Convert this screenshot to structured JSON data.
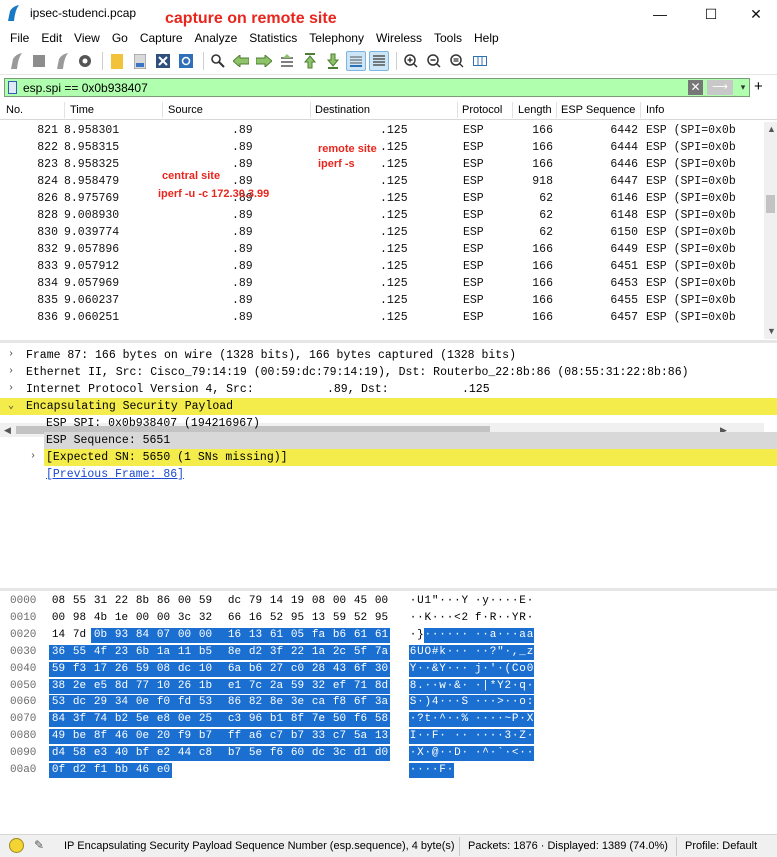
{
  "window": {
    "title": "ipsec-studenci.pcap",
    "annotation": "capture on remote site",
    "minimize": "—",
    "maximize": "☐",
    "close": "✕"
  },
  "menu": [
    "File",
    "Edit",
    "View",
    "Go",
    "Capture",
    "Analyze",
    "Statistics",
    "Telephony",
    "Wireless",
    "Tools",
    "Help"
  ],
  "filter": {
    "value": "esp.spi == 0x0b938407",
    "clear": "✕",
    "apply": "⟶",
    "dropdown": "▾",
    "add": "+"
  },
  "columns": [
    "No.",
    "Time",
    "Source",
    "Destination",
    "Protocol",
    "Length",
    "ESP Sequence",
    "Info"
  ],
  "packets": [
    {
      "no": "821",
      "time": "8.958301",
      "src": ".89",
      "dst": ".125",
      "proto": "ESP",
      "len": "166",
      "seq": "6442",
      "info": "ESP (SPI=0x0b"
    },
    {
      "no": "822",
      "time": "8.958315",
      "src": ".89",
      "dst": ".125",
      "proto": "ESP",
      "len": "166",
      "seq": "6444",
      "info": "ESP (SPI=0x0b"
    },
    {
      "no": "823",
      "time": "8.958325",
      "src": ".89",
      "dst": ".125",
      "proto": "ESP",
      "len": "166",
      "seq": "6446",
      "info": "ESP (SPI=0x0b"
    },
    {
      "no": "824",
      "time": "8.958479",
      "src": ".89",
      "dst": ".125",
      "proto": "ESP",
      "len": "918",
      "seq": "6447",
      "info": "ESP (SPI=0x0b"
    },
    {
      "no": "826",
      "time": "8.975769",
      "src": ".89",
      "dst": ".125",
      "proto": "ESP",
      "len": "62",
      "seq": "6146",
      "info": "ESP (SPI=0x0b"
    },
    {
      "no": "828",
      "time": "9.008930",
      "src": ".89",
      "dst": ".125",
      "proto": "ESP",
      "len": "62",
      "seq": "6148",
      "info": "ESP (SPI=0x0b"
    },
    {
      "no": "830",
      "time": "9.039774",
      "src": ".89",
      "dst": ".125",
      "proto": "ESP",
      "len": "62",
      "seq": "6150",
      "info": "ESP (SPI=0x0b"
    },
    {
      "no": "832",
      "time": "9.057896",
      "src": ".89",
      "dst": ".125",
      "proto": "ESP",
      "len": "166",
      "seq": "6449",
      "info": "ESP (SPI=0x0b"
    },
    {
      "no": "833",
      "time": "9.057912",
      "src": ".89",
      "dst": ".125",
      "proto": "ESP",
      "len": "166",
      "seq": "6451",
      "info": "ESP (SPI=0x0b"
    },
    {
      "no": "834",
      "time": "9.057969",
      "src": ".89",
      "dst": ".125",
      "proto": "ESP",
      "len": "166",
      "seq": "6453",
      "info": "ESP (SPI=0x0b"
    },
    {
      "no": "835",
      "time": "9.060237",
      "src": ".89",
      "dst": ".125",
      "proto": "ESP",
      "len": "166",
      "seq": "6455",
      "info": "ESP (SPI=0x0b"
    },
    {
      "no": "836",
      "time": "9.060251",
      "src": ".89",
      "dst": ".125",
      "proto": "ESP",
      "len": "166",
      "seq": "6457",
      "info": "ESP (SPI=0x0b"
    }
  ],
  "annotations": {
    "remote_line1": "remote site",
    "remote_line2": "iperf -s",
    "central_line1": "central site",
    "central_line2": "iperf -u -c 172.30.3.99"
  },
  "details": {
    "frame": "Frame 87: 166 bytes on wire (1328 bits), 166 bytes captured (1328 bits)",
    "ethernet": "Ethernet II, Src: Cisco_79:14:19 (00:59:dc:79:14:19), Dst: Routerbo_22:8b:86 (08:55:31:22:8b:86)",
    "ip_prefix": "Internet Protocol Version 4, Src:",
    "ip_src": ".89,",
    "ip_dst_label": "Dst:",
    "ip_dst": ".125",
    "esp": "Encapsulating Security Payload",
    "spi": "ESP SPI: 0x0b938407 (194216967)",
    "seq": "ESP Sequence: 5651",
    "expected": "[Expected SN: 5650 (1 SNs missing)]",
    "prev": "[Previous Frame: 86]"
  },
  "hex": [
    {
      "off": "0000",
      "bytes": [
        "08",
        "55",
        "31",
        "22",
        "8b",
        "86",
        "00",
        "59",
        "dc",
        "79",
        "14",
        "19",
        "08",
        "00",
        "45",
        "00"
      ],
      "ascii": [
        "·",
        "U",
        "1",
        "\"",
        "·",
        "·",
        "·",
        "Y",
        "·",
        "y",
        "·",
        "·",
        "·",
        "·",
        "E",
        "·"
      ]
    },
    {
      "off": "0010",
      "bytes": [
        "00",
        "98",
        "4b",
        "1e",
        "00",
        "00",
        "3c",
        "32",
        "66",
        "16",
        "52",
        "95",
        "13",
        "59",
        "52",
        "95"
      ],
      "ascii": [
        "·",
        "·",
        "K",
        "·",
        "·",
        "·",
        "<",
        "2",
        "f",
        "·",
        "R",
        "·",
        "·",
        "Y",
        "R",
        "·"
      ]
    },
    {
      "off": "0020",
      "bytes": [
        "14",
        "7d",
        "0b",
        "93",
        "84",
        "07",
        "00",
        "00",
        "16",
        "13",
        "61",
        "05",
        "fa",
        "b6",
        "61",
        "61"
      ],
      "ascii": [
        "·",
        "}",
        "·",
        "·",
        "·",
        "·",
        "·",
        "·",
        "·",
        "·",
        "a",
        "·",
        "·",
        "·",
        "a",
        "a"
      ]
    },
    {
      "off": "0030",
      "bytes": [
        "36",
        "55",
        "4f",
        "23",
        "6b",
        "1a",
        "11",
        "b5",
        "8e",
        "d2",
        "3f",
        "22",
        "1a",
        "2c",
        "5f",
        "7a"
      ],
      "ascii": [
        "6",
        "U",
        "O",
        "#",
        "k",
        "·",
        "·",
        "·",
        "·",
        "·",
        "?",
        "\"",
        "·",
        ",",
        "_",
        "z"
      ]
    },
    {
      "off": "0040",
      "bytes": [
        "59",
        "f3",
        "17",
        "26",
        "59",
        "08",
        "dc",
        "10",
        "6a",
        "b6",
        "27",
        "c0",
        "28",
        "43",
        "6f",
        "30"
      ],
      "ascii": [
        "Y",
        "·",
        "·",
        "&",
        "Y",
        "·",
        "·",
        "·",
        "j",
        "·",
        "'",
        "·",
        "(",
        "C",
        "o",
        "0"
      ]
    },
    {
      "off": "0050",
      "bytes": [
        "38",
        "2e",
        "e5",
        "8d",
        "77",
        "10",
        "26",
        "1b",
        "e1",
        "7c",
        "2a",
        "59",
        "32",
        "ef",
        "71",
        "8d"
      ],
      "ascii": [
        "8",
        ".",
        "·",
        "·",
        "w",
        "·",
        "&",
        "·",
        "·",
        "|",
        "*",
        "Y",
        "2",
        "·",
        "q",
        "·"
      ]
    },
    {
      "off": "0060",
      "bytes": [
        "53",
        "dc",
        "29",
        "34",
        "0e",
        "f0",
        "fd",
        "53",
        "86",
        "82",
        "8e",
        "3e",
        "ca",
        "f8",
        "6f",
        "3a"
      ],
      "ascii": [
        "S",
        "·",
        ")",
        "4",
        "·",
        "·",
        "·",
        "S",
        "·",
        "·",
        "·",
        ">",
        "·",
        "·",
        "o",
        ":"
      ]
    },
    {
      "off": "0070",
      "bytes": [
        "84",
        "3f",
        "74",
        "b2",
        "5e",
        "e8",
        "0e",
        "25",
        "c3",
        "96",
        "b1",
        "8f",
        "7e",
        "50",
        "f6",
        "58"
      ],
      "ascii": [
        "·",
        "?",
        "t",
        "·",
        "^",
        "·",
        "·",
        "%",
        "·",
        "·",
        "·",
        "·",
        "~",
        "P",
        "·",
        "X"
      ]
    },
    {
      "off": "0080",
      "bytes": [
        "49",
        "be",
        "8f",
        "46",
        "0e",
        "20",
        "f9",
        "b7",
        "ff",
        "a6",
        "c7",
        "b7",
        "33",
        "c7",
        "5a",
        "13"
      ],
      "ascii": [
        "I",
        "·",
        "·",
        "F",
        "·",
        " ",
        "·",
        "·",
        "·",
        "·",
        "·",
        "·",
        "3",
        "·",
        "Z",
        "·"
      ]
    },
    {
      "off": "0090",
      "bytes": [
        "d4",
        "58",
        "e3",
        "40",
        "bf",
        "e2",
        "44",
        "c8",
        "b7",
        "5e",
        "f6",
        "60",
        "dc",
        "3c",
        "d1",
        "d0"
      ],
      "ascii": [
        "·",
        "X",
        "·",
        "@",
        "·",
        "·",
        "D",
        "·",
        "·",
        "^",
        "·",
        "`",
        "·",
        "<",
        "·",
        "·"
      ]
    },
    {
      "off": "00a0",
      "bytes": [
        "0f",
        "d2",
        "f1",
        "bb",
        "46",
        "e0"
      ],
      "ascii": [
        "·",
        "·",
        "·",
        "·",
        "F",
        "·"
      ]
    }
  ],
  "status": {
    "field": "IP Encapsulating Security Payload Sequence Number (esp.sequence), 4 byte(s)",
    "packets": "Packets: 1876 · Displayed: 1389 (74.0%)",
    "profile": "Profile: Default"
  },
  "colors": {
    "filter_bg": "#afffaf",
    "highlight_yellow": "#f4ec4a",
    "selection_blue": "#1a6fd1",
    "annotation_red": "#e8261d"
  }
}
